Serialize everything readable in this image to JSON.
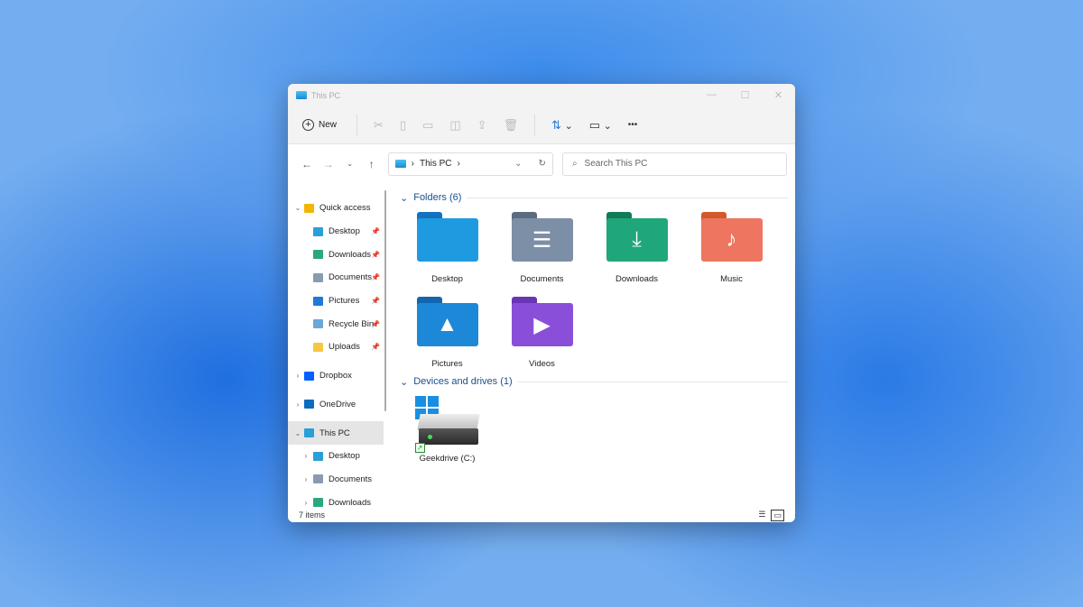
{
  "window": {
    "title": "This PC",
    "controls": [
      "—",
      "☐",
      "✕"
    ]
  },
  "toolbar": {
    "new_label": "New",
    "icons": [
      "cut-icon",
      "copy-icon",
      "paste-icon",
      "rename-icon",
      "share-icon",
      "delete-icon"
    ],
    "sort": "⇅",
    "view": "▭",
    "more": "•••"
  },
  "address": {
    "path": "This PC",
    "separator": "›",
    "search_placeholder": "Search This PC"
  },
  "sidebar": {
    "items": [
      {
        "label": "Quick access",
        "color": "#f5b400",
        "chev": "⌄",
        "indent": 0
      },
      {
        "label": "Desktop",
        "color": "#2a9fd8",
        "pin": true,
        "indent": 1
      },
      {
        "label": "Downloads",
        "color": "#2aa87a",
        "pin": true,
        "indent": 1
      },
      {
        "label": "Documents",
        "color": "#8a9bb0",
        "pin": true,
        "indent": 1
      },
      {
        "label": "Pictures",
        "color": "#1e7ad6",
        "pin": true,
        "indent": 1
      },
      {
        "label": "Recycle Bin",
        "color": "#6aa8d8",
        "pin": true,
        "indent": 1
      },
      {
        "label": "Uploads",
        "color": "#f5c842",
        "pin": true,
        "indent": 1
      },
      {
        "label": "Dropbox",
        "color": "#0061fe",
        "chev": "›",
        "indent": 0
      },
      {
        "label": "OneDrive",
        "color": "#0f6cbd",
        "chev": "›",
        "indent": 0
      },
      {
        "label": "This PC",
        "color": "#2a9fd8",
        "chev": "⌄",
        "indent": 0,
        "selected": true
      },
      {
        "label": "Desktop",
        "color": "#2a9fd8",
        "chev": "›",
        "indent": 1
      },
      {
        "label": "Documents",
        "color": "#8a9bb0",
        "chev": "›",
        "indent": 1
      },
      {
        "label": "Downloads",
        "color": "#2aa87a",
        "chev": "›",
        "indent": 1
      }
    ]
  },
  "main": {
    "folders_header": "Folders (6)",
    "folders": [
      {
        "label": "Desktop",
        "color": "#1e9be0",
        "tab": "#1570c0",
        "glyph": ""
      },
      {
        "label": "Documents",
        "color": "#7d8fa6",
        "tab": "#5b6b80",
        "glyph": "☰"
      },
      {
        "label": "Downloads",
        "color": "#1fa67a",
        "tab": "#137a58",
        "glyph": "⤓"
      },
      {
        "label": "Music",
        "color": "#ee7560",
        "tab": "#d25a2a",
        "glyph": "♪"
      },
      {
        "label": "Pictures",
        "color": "#1e88d8",
        "tab": "#1465b0",
        "glyph": "▲"
      },
      {
        "label": "Videos",
        "color": "#8a4fd8",
        "tab": "#6a35b5",
        "glyph": "▶"
      }
    ],
    "drives_header": "Devices and drives (1)",
    "drives": [
      {
        "label": "Geekdrive (C:)"
      }
    ]
  },
  "status": {
    "items": "7 items"
  }
}
